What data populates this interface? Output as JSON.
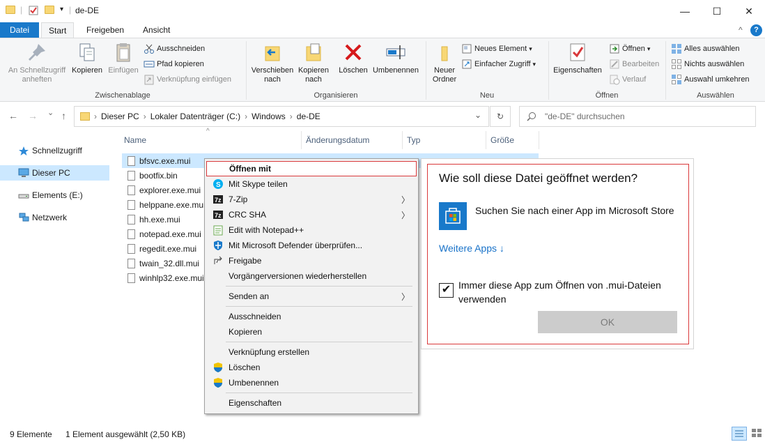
{
  "window": {
    "title": "de-DE",
    "minimize_glyph": "—",
    "maximize_glyph": "☐",
    "close_glyph": "✕"
  },
  "quick_access": {
    "dropdown": "▾",
    "separator": "|"
  },
  "tabs": [
    {
      "label": "Datei"
    },
    {
      "label": "Start"
    },
    {
      "label": "Freigeben"
    },
    {
      "label": "Ansicht"
    }
  ],
  "ribbon_extras": {
    "collapse": "^",
    "help": "?"
  },
  "ribbon": {
    "clipboard": {
      "pin": "An Schnellzugriff anheften",
      "copy": "Kopieren",
      "paste": "Einfügen",
      "cut": "Ausschneiden",
      "copy_path": "Pfad kopieren",
      "paste_shortcut": "Verknüpfung einfügen",
      "group": "Zwischenablage"
    },
    "organize": {
      "move": "Verschieben nach",
      "copy_to": "Kopieren nach",
      "delete": "Löschen",
      "rename": "Umbenennen",
      "group": "Organisieren"
    },
    "new": {
      "folder": "Neuer Ordner",
      "new_item": "Neues Element",
      "easy_access": "Einfacher Zugriff",
      "group": "Neu"
    },
    "open": {
      "properties": "Eigenschaften",
      "open": "Öffnen",
      "edit": "Bearbeiten",
      "history": "Verlauf",
      "group": "Öffnen"
    },
    "select": {
      "all": "Alles auswählen",
      "none": "Nichts auswählen",
      "invert": "Auswahl umkehren",
      "group": "Auswählen"
    }
  },
  "nav": {
    "back": "←",
    "forward": "→",
    "recent": "⌄",
    "up": "↑"
  },
  "breadcrumb": [
    "Dieser PC",
    "Lokaler Datenträger (C:)",
    "Windows",
    "de-DE"
  ],
  "breadcrumb_sep": "›",
  "address_dropdown": "⌄",
  "refresh_glyph": "↻",
  "search": {
    "placeholder": "\"de-DE\" durchsuchen"
  },
  "sidebar": [
    {
      "label": "Schnellzugriff",
      "icon": "star-icon"
    },
    {
      "label": "Dieser PC",
      "icon": "computer-icon"
    },
    {
      "label": "Elements (E:)",
      "icon": "drive-icon"
    },
    {
      "label": "Netzwerk",
      "icon": "network-icon"
    }
  ],
  "columns": {
    "name": "Name",
    "date": "Änderungsdatum",
    "type": "Typ",
    "size": "Größe",
    "sort_glyph": "^"
  },
  "files": [
    "bfsvc.exe.mui",
    "bootfix.bin",
    "explorer.exe.mui",
    "helppane.exe.mui",
    "hh.exe.mui",
    "notepad.exe.mui",
    "regedit.exe.mui",
    "twain_32.dll.mui",
    "winhlp32.exe.mui"
  ],
  "context_menu": {
    "open_with": "Öffnen mit",
    "skype": "Mit Skype teilen",
    "sevenzip": "7-Zip",
    "crc": "CRC SHA",
    "notepadpp": "Edit with Notepad++",
    "defender": "Mit Microsoft Defender überprüfen...",
    "share": "Freigabe",
    "restore": "Vorgängerversionen wiederherstellen",
    "send_to": "Senden an",
    "cut": "Ausschneiden",
    "copy": "Kopieren",
    "create_shortcut": "Verknüpfung erstellen",
    "delete": "Löschen",
    "rename": "Umbenennen",
    "properties": "Eigenschaften",
    "submenu_arrow": "〉"
  },
  "dialog": {
    "title": "Wie soll diese Datei geöffnet werden?",
    "store_text": "Suchen Sie nach einer App im Microsoft Store",
    "more_apps": "Weitere Apps ↓",
    "always_use": "Immer diese App zum Öffnen von .mui-Dateien verwenden",
    "always_checked": true,
    "checkmark": "✔",
    "ok": "OK"
  },
  "status": {
    "count": "9 Elemente",
    "selection": "1 Element ausgewählt (2,50 KB)"
  },
  "colors": {
    "accent": "#1979ca",
    "selection": "#cce8ff",
    "highlight_border": "#d9383a",
    "link": "#1a73c9"
  }
}
